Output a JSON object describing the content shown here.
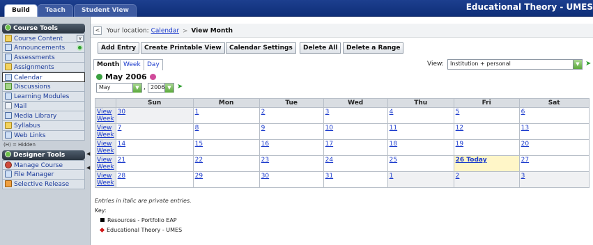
{
  "top_tabs": [
    {
      "label": "Build",
      "active": true
    },
    {
      "label": "Teach",
      "active": false
    },
    {
      "label": "Student View",
      "active": false
    }
  ],
  "course_title": "Educational Theory - UMES",
  "sidebar": {
    "course_tools_header": "Course Tools",
    "course_tools": [
      {
        "label": "Course Content",
        "icon": "folder-icon"
      },
      {
        "label": "Announcements",
        "icon": "megaphone-icon"
      },
      {
        "label": "Assessments",
        "icon": "assessment-icon"
      },
      {
        "label": "Assignments",
        "icon": "assignment-icon"
      },
      {
        "label": "Calendar",
        "icon": "calendar-icon"
      },
      {
        "label": "Discussions",
        "icon": "discussion-icon"
      },
      {
        "label": "Learning Modules",
        "icon": "module-icon"
      },
      {
        "label": "Mail",
        "icon": "mail-icon"
      },
      {
        "label": "Media Library",
        "icon": "media-icon"
      },
      {
        "label": "Syllabus",
        "icon": "syllabus-icon"
      },
      {
        "label": "Web Links",
        "icon": "weblink-icon"
      }
    ],
    "hidden_note": "(H) = Hidden",
    "designer_tools_header": "Designer Tools",
    "designer_tools": [
      {
        "label": "Manage Course",
        "icon": "manage-icon"
      },
      {
        "label": "File Manager",
        "icon": "file-icon"
      },
      {
        "label": "Selective Release",
        "icon": "release-icon"
      }
    ]
  },
  "breadcrumb": {
    "back": "<",
    "prefix": "Your location:",
    "link": "Calendar",
    "separator": ">",
    "current": "View Month"
  },
  "toolbar": [
    "Add Entry",
    "Create Printable View",
    "Calendar Settings",
    "Delete All",
    "Delete a Range"
  ],
  "view_tabs": [
    {
      "label": "Month",
      "active": true
    },
    {
      "label": "Week",
      "active": false
    },
    {
      "label": "Day",
      "active": false
    }
  ],
  "view_filter": {
    "label": "View:",
    "value": "Institution + personal"
  },
  "month_heading": "May 2006",
  "month_select": "May",
  "year_select": "2006",
  "calendar": {
    "headers": [
      "",
      "Sun",
      "Mon",
      "Tue",
      "Wed",
      "Thu",
      "Fri",
      "Sat"
    ],
    "week_link": "View Week",
    "weeks": [
      [
        "30",
        "1",
        "2",
        "3",
        "4",
        "5",
        "6"
      ],
      [
        "7",
        "8",
        "9",
        "10",
        "11",
        "12",
        "13"
      ],
      [
        "14",
        "15",
        "16",
        "17",
        "18",
        "19",
        "20"
      ],
      [
        "21",
        "22",
        "23",
        "24",
        "25",
        "26 Today",
        "27"
      ],
      [
        "28",
        "29",
        "30",
        "31",
        "1",
        "2",
        "3"
      ]
    ]
  },
  "legend_note": "Entries in italic are private entries.",
  "key_label": "Key:",
  "key_items": [
    {
      "label": "Resources - Portfolio EAP",
      "marker": "square"
    },
    {
      "label": "Educational Theory - UMES",
      "marker": "diamond"
    }
  ],
  "colors": {
    "topbar": "#1d3f8f",
    "today": "#fff6c8",
    "link": "#1a3acc"
  }
}
